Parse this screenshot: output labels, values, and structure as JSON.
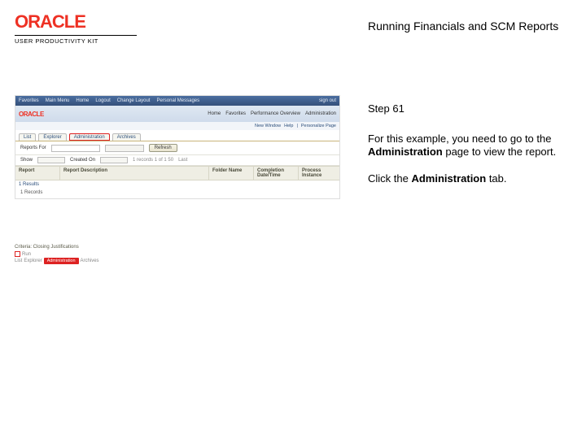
{
  "brand": {
    "logo_text": "ORACLE",
    "subtitle": "USER PRODUCTIVITY KIT"
  },
  "doc": {
    "title": "Running Financials and SCM Reports",
    "step_label": "Step 61",
    "para1_pre": "For this example, you need to go to the ",
    "para1_bold": "Administration",
    "para1_post": " page to view the report.",
    "para2_pre": "Click the ",
    "para2_bold": "Administration",
    "para2_post": " tab."
  },
  "app": {
    "topbar": {
      "items": [
        "Favorites",
        "Main Menu",
        "Home",
        "Logout",
        "Change Layout",
        "Personal Messages"
      ],
      "right": "sign out"
    },
    "header2_items": [
      "Home",
      "Favorites",
      "Performance Overview",
      "Administration"
    ],
    "subbar": {
      "left": "New Window",
      "sep": "|",
      "mid": "Help",
      "right": "Personalize Page"
    },
    "tabs": [
      "List",
      "Explorer",
      "Administration",
      "Archives"
    ],
    "search": {
      "label": "Reports For",
      "refresh_btn": "Refresh"
    },
    "filter": {
      "show_label": "Show",
      "created_label": "Created On",
      "pager": "1 records   1   of 1   50",
      "last_part": "Last"
    },
    "grid": {
      "headers": [
        "Report",
        "Report Description",
        "Folder Name",
        "Completion Date/Time",
        "Process Instance"
      ],
      "row_link": "1 Results"
    },
    "footer_count": "1 Records"
  },
  "inset": {
    "title": "Criteria: Closing Justifications",
    "row1_text": "Run",
    "row2_left": "List",
    "row2_mid": "Explorer",
    "row2_admin": "Administration",
    "row2_right": "Archives"
  }
}
